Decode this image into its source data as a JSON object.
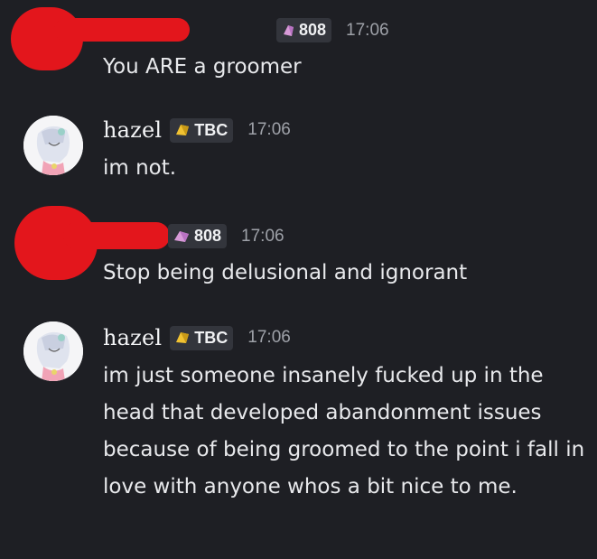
{
  "messages": [
    {
      "author": "",
      "tag": "808",
      "time": "17:06",
      "text": "You ARE a groomer"
    },
    {
      "author": "hazel",
      "tag": "TBC",
      "time": "17:06",
      "text": "im not."
    },
    {
      "author": "",
      "tag": "808",
      "time": "17:06",
      "text": "Stop being delusional and ignorant"
    },
    {
      "author": "hazel",
      "tag": "TBC",
      "time": "17:06",
      "text": "im just someone insanely fucked up in the head that developed abandonment issues because of being groomed to the point i fall in love with anyone whos a bit nice to me."
    }
  ],
  "icons": {
    "tag_808": "pink-gem-icon",
    "tag_tbc": "yellow-gem-icon"
  },
  "colors": {
    "background": "#1e1f24",
    "redaction": "#e3161c",
    "timestamp": "#9ea1a8",
    "tag_bg": "#33353c",
    "gem_pink": "#d89ad8",
    "gem_yellow": "#f1c232"
  }
}
